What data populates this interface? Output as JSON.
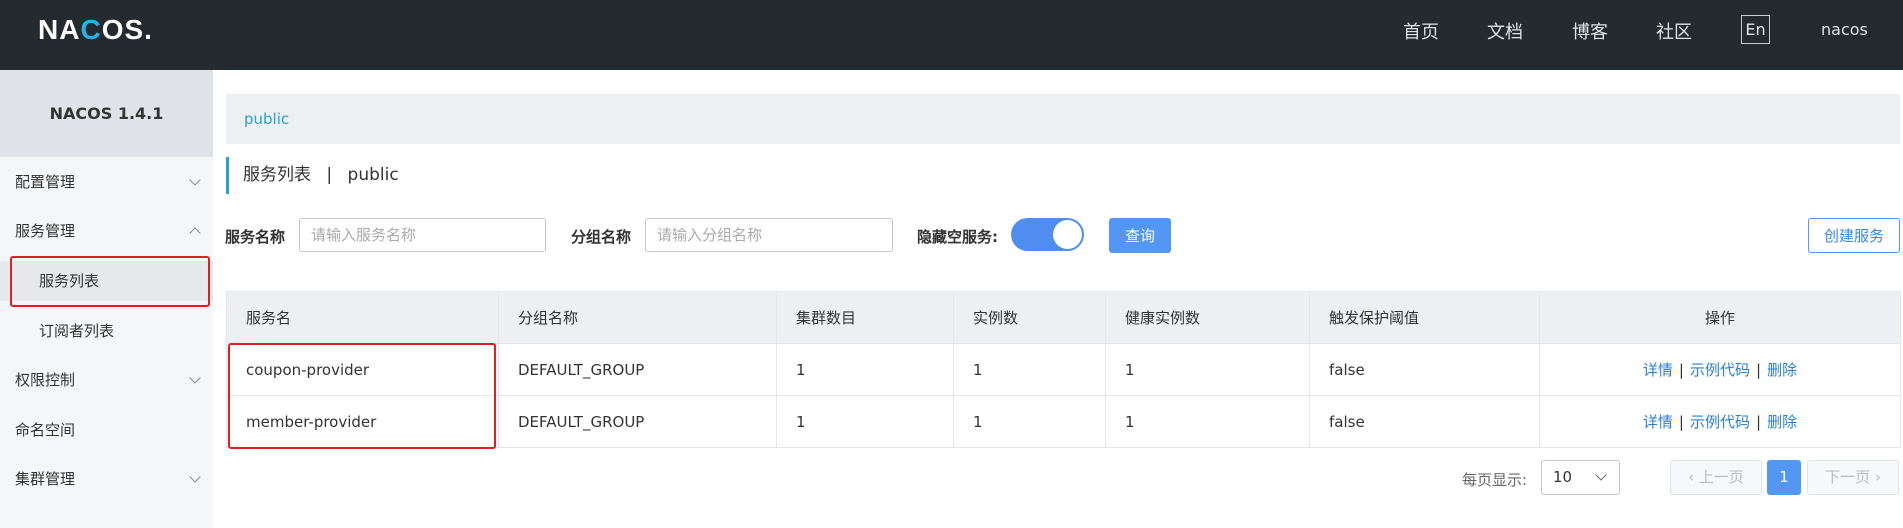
{
  "header": {
    "logo_text_pre": "NA",
    "logo_text_o": "C",
    "logo_text_post": "OS.",
    "nav": [
      "首页",
      "文档",
      "博客",
      "社区"
    ],
    "lang_button": "En",
    "username": "nacos"
  },
  "sidebar": {
    "version": "NACOS 1.4.1",
    "items": [
      {
        "label": "配置管理",
        "expanded": false
      },
      {
        "label": "服务管理",
        "expanded": true
      },
      {
        "label": "服务列表",
        "sub": true,
        "active": true
      },
      {
        "label": "订阅者列表",
        "sub": true
      },
      {
        "label": "权限控制",
        "expanded": false
      },
      {
        "label": "命名空间"
      },
      {
        "label": "集群管理",
        "expanded": false
      }
    ]
  },
  "breadcrumb": "public",
  "page_title": {
    "main": "服务列表",
    "separator": "|",
    "namespace": "public"
  },
  "filters": {
    "service_label": "服务名称",
    "service_placeholder": "请输入服务名称",
    "group_label": "分组名称",
    "group_placeholder": "请输入分组名称",
    "hide_empty_label": "隐藏空服务:",
    "hide_empty_on": true,
    "query_button": "查询",
    "create_button": "创建服务"
  },
  "table": {
    "columns": [
      "服务名",
      "分组名称",
      "集群数目",
      "实例数",
      "健康实例数",
      "触发保护阈值",
      "操作"
    ],
    "rows": [
      {
        "name": "coupon-provider",
        "group": "DEFAULT_GROUP",
        "clusters": "1",
        "instances": "1",
        "healthy": "1",
        "threshold": "false"
      },
      {
        "name": "member-provider",
        "group": "DEFAULT_GROUP",
        "clusters": "1",
        "instances": "1",
        "healthy": "1",
        "threshold": "false"
      }
    ],
    "actions": {
      "detail": "详情",
      "sample": "示例代码",
      "delete": "删除",
      "sep": "|"
    }
  },
  "pagination": {
    "per_page_label": "每页显示:",
    "per_page_value": "10",
    "prev": "上一页",
    "current": "1",
    "next": "下一页"
  },
  "colors": {
    "accent": "#5297f3",
    "header_bg": "#252a2f",
    "highlight_border": "#e02020"
  }
}
